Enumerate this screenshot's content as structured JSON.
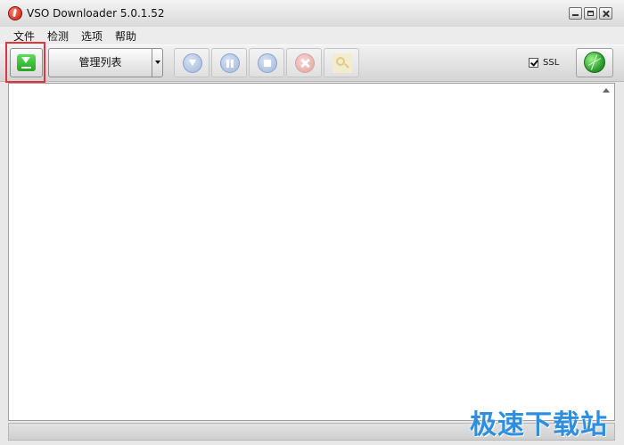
{
  "window": {
    "title": "VSO Downloader 5.0.1.52"
  },
  "menu": {
    "items": [
      "文件",
      "检测",
      "选项",
      "帮助"
    ]
  },
  "toolbar": {
    "list_button_label": "管理列表",
    "ssl_label": "SSL",
    "ssl_checked": true,
    "icons": [
      "add-download-icon",
      "download-icon",
      "pause-icon",
      "stop-icon",
      "delete-icon",
      "find-icon",
      "globe-icon"
    ]
  },
  "watermark": "极速下载站",
  "colors": {
    "highlight": "#e0353b",
    "add_button": "#23a81f",
    "watermark": "#2e8fe0"
  }
}
